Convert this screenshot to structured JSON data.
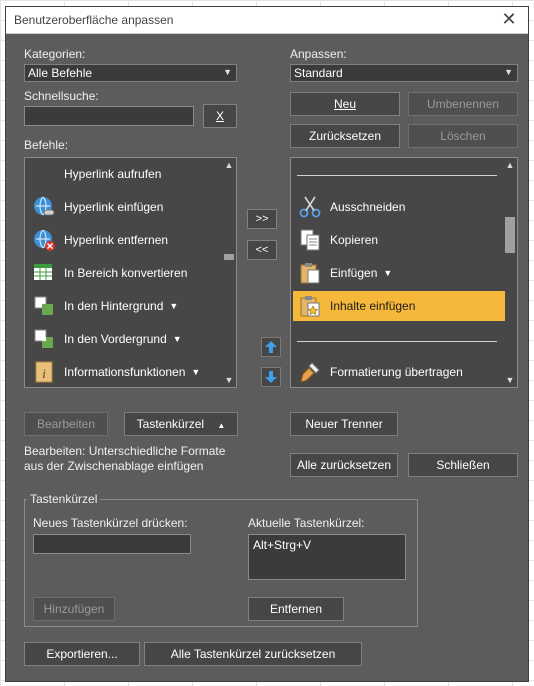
{
  "dialog": {
    "title": "Benutzeroberfläche anpassen",
    "close_label": "✕"
  },
  "left": {
    "kategorien_label": "Kategorien:",
    "kategorien_value": "Alle Befehle",
    "schnellsuche_label": "Schnellsuche:",
    "schnellsuche_value": "",
    "clear_button": "X",
    "befehle_label": "Befehle:",
    "commands": [
      {
        "label": "Hyperlink aufrufen",
        "icon": "none"
      },
      {
        "label": "Hyperlink einfügen",
        "icon": "hyperlink-insert-icon"
      },
      {
        "label": "Hyperlink entfernen",
        "icon": "hyperlink-remove-icon"
      },
      {
        "label": "In Bereich konvertieren",
        "icon": "convert-range-icon"
      },
      {
        "label": "In den Hintergrund",
        "icon": "send-backward-icon",
        "dropdown": "▼"
      },
      {
        "label": "In den Vordergrund",
        "icon": "bring-forward-icon",
        "dropdown": "▼"
      },
      {
        "label": "Informationsfunktionen",
        "icon": "info-function-icon",
        "dropdown": "▼"
      }
    ],
    "edit_button": "Bearbeiten",
    "shortcut_button": "Tastenkürzel",
    "shortcut_arrow": "▲",
    "description": "Bearbeiten: Unterschiedliche Formate aus der Zwischenablage einfügen"
  },
  "middle": {
    "add_button": ">>",
    "remove_button": "<<"
  },
  "right": {
    "anpassen_label": "Anpassen:",
    "anpassen_value": "Standard",
    "new_button": "Neu",
    "rename_button": "Umbenennen",
    "reset_button": "Zurücksetzen",
    "delete_button": "Löschen",
    "items": [
      {
        "label": "Ausschneiden",
        "icon": "scissors-icon"
      },
      {
        "label": "Kopieren",
        "icon": "copy-icon"
      },
      {
        "label": "Einfügen",
        "icon": "paste-icon",
        "dropdown": "▼"
      },
      {
        "label": "Inhalte einfügen",
        "icon": "paste-special-icon",
        "selected": true
      },
      {
        "label": "Formatierung übertragen",
        "icon": "format-painter-icon"
      }
    ],
    "new_separator_button": "Neuer Trenner",
    "reset_all_button": "Alle zurücksetzen",
    "close_button": "Schließen"
  },
  "shortcuts": {
    "group_title": "Tastenkürzel",
    "new_label": "Neues Tastenkürzel drücken:",
    "new_value": "",
    "current_label": "Aktuelle Tastenkürzel:",
    "current_value": "Alt+Strg+V",
    "add_button": "Hinzufügen",
    "remove_button": "Entfernen"
  },
  "footer": {
    "export_button": "Exportieren...",
    "reset_all_shortcuts_button": "Alle Tastenkürzel zurücksetzen"
  },
  "colors": {
    "dialog_bg": "#5c5c5c",
    "selection": "#f5b83b",
    "arrow_blue": "#3ea0e8"
  }
}
